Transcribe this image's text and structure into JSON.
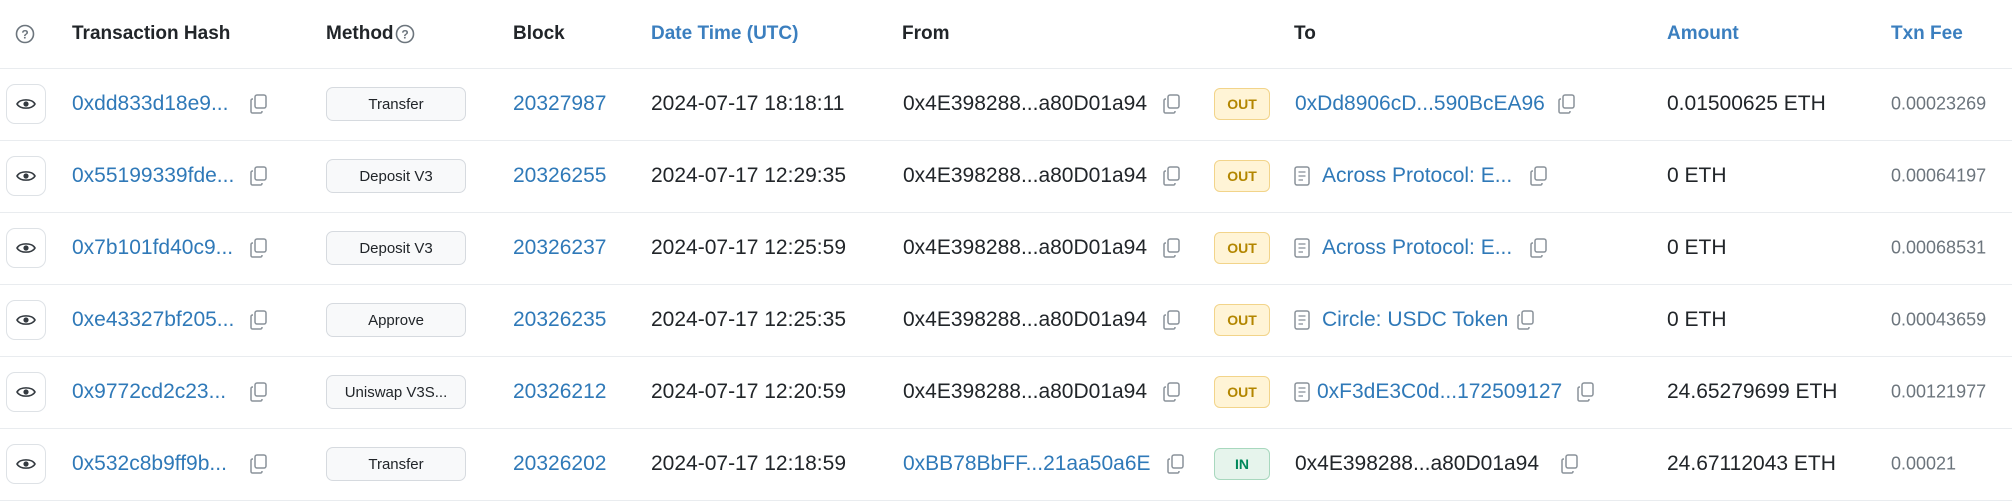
{
  "header": {
    "hash_label": "Transaction Hash",
    "method_label": "Method",
    "block_label": "Block",
    "datetime_label": "Date Time (UTC)",
    "from_label": "From",
    "to_label": "To",
    "amount_label": "Amount",
    "fee_label": "Txn Fee"
  },
  "rows": [
    {
      "hash": "0xdd833d18e9...",
      "method": "Transfer",
      "block": "20327987",
      "datetime": "2024-07-17 18:18:11",
      "from": "0x4E398288...a80D01a94",
      "direction": "OUT",
      "to": "0xDd8906cD...590BcEA96",
      "amount": "0.01500625 ETH",
      "fee": "0.00023269"
    },
    {
      "hash": "0x55199339fde...",
      "method": "Deposit V3",
      "block": "20326255",
      "datetime": "2024-07-17 12:29:35",
      "from": "0x4E398288...a80D01a94",
      "direction": "OUT",
      "to": "Across Protocol: E...",
      "amount": "0 ETH",
      "fee": "0.00064197"
    },
    {
      "hash": "0x7b101fd40c9...",
      "method": "Deposit V3",
      "block": "20326237",
      "datetime": "2024-07-17 12:25:59",
      "from": "0x4E398288...a80D01a94",
      "direction": "OUT",
      "to": "Across Protocol: E...",
      "amount": "0 ETH",
      "fee": "0.00068531"
    },
    {
      "hash": "0xe43327bf205...",
      "method": "Approve",
      "block": "20326235",
      "datetime": "2024-07-17 12:25:35",
      "from": "0x4E398288...a80D01a94",
      "direction": "OUT",
      "to": "Circle: USDC Token",
      "amount": "0 ETH",
      "fee": "0.00043659"
    },
    {
      "hash": "0x9772cd2c23...",
      "method": "Uniswap V3S...",
      "block": "20326212",
      "datetime": "2024-07-17 12:20:59",
      "from": "0x4E398288...a80D01a94",
      "direction": "OUT",
      "to": "0xF3dE3C0d...172509127",
      "amount": "24.65279699 ETH",
      "fee": "0.00121977"
    },
    {
      "hash": "0x532c8b9ff9b...",
      "method": "Transfer",
      "block": "20326202",
      "datetime": "2024-07-17 12:18:59",
      "from": "0xBB78BbFF...21aa50a6E",
      "direction": "IN",
      "to": "0x4E398288...a80D01a94",
      "amount": "24.67112043 ETH",
      "fee": "0.00021"
    }
  ],
  "colors": {
    "link": "#2f79b8",
    "out_badge": "#b38600",
    "in_badge": "#00875a"
  },
  "icons": [
    "help-icon",
    "eye-icon",
    "copy-icon",
    "contract-icon"
  ]
}
